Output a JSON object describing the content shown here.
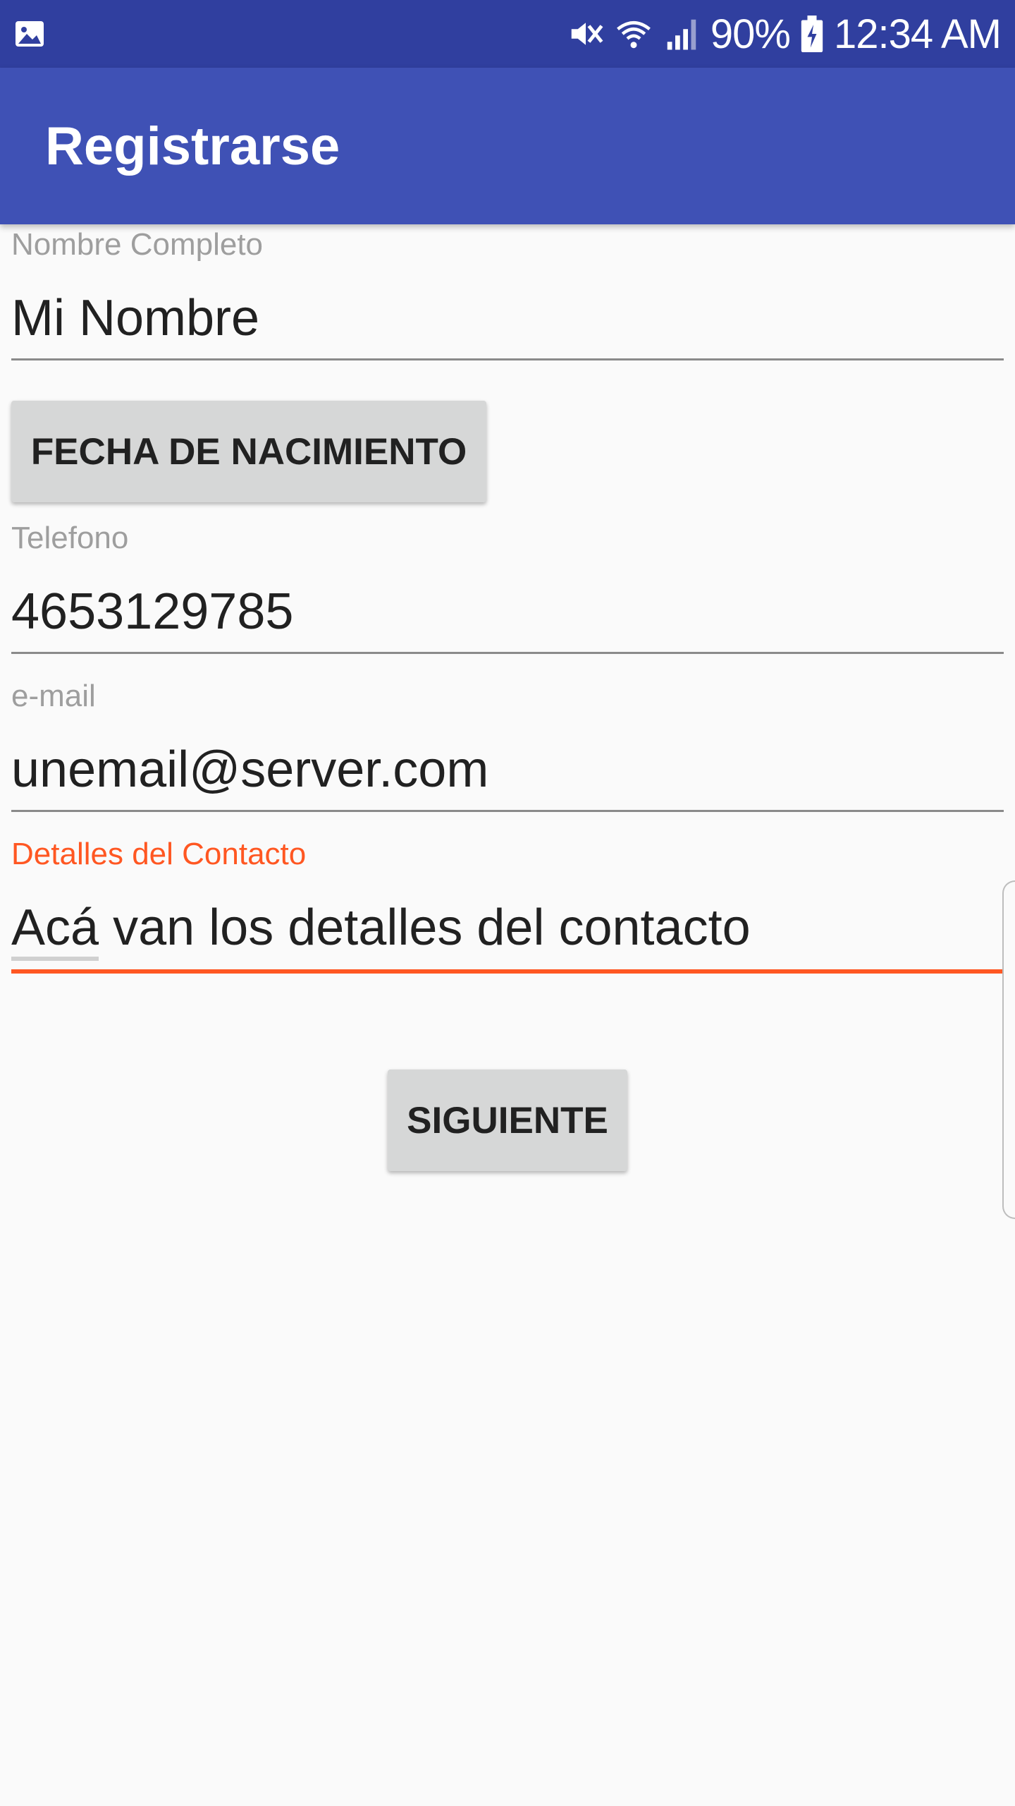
{
  "status_bar": {
    "left_icon": "gallery-icon",
    "icons": [
      "mute-icon",
      "wifi-icon",
      "signal-icon",
      "battery-icon"
    ],
    "battery": "90%",
    "time": "12:34 AM"
  },
  "app_bar": {
    "title": "Registrarse"
  },
  "form": {
    "nombre": {
      "label": "Nombre Completo",
      "value": "Mi Nombre"
    },
    "fecha_button": "FECHA DE NACIMIENTO",
    "telefono": {
      "label": "Telefono",
      "value": "4653129785"
    },
    "email": {
      "label": "e-mail",
      "value": "unemail@server.com"
    },
    "detalles": {
      "label": "Detalles del Contacto",
      "value": "Acá van los detalles del contacto"
    },
    "next_button": "SIGUIENTE"
  },
  "colors": {
    "status_bar": "#303f9f",
    "app_bar": "#3f51b5",
    "accent": "#ff5722",
    "background": "#fafafa",
    "button": "#d6d7d7"
  }
}
